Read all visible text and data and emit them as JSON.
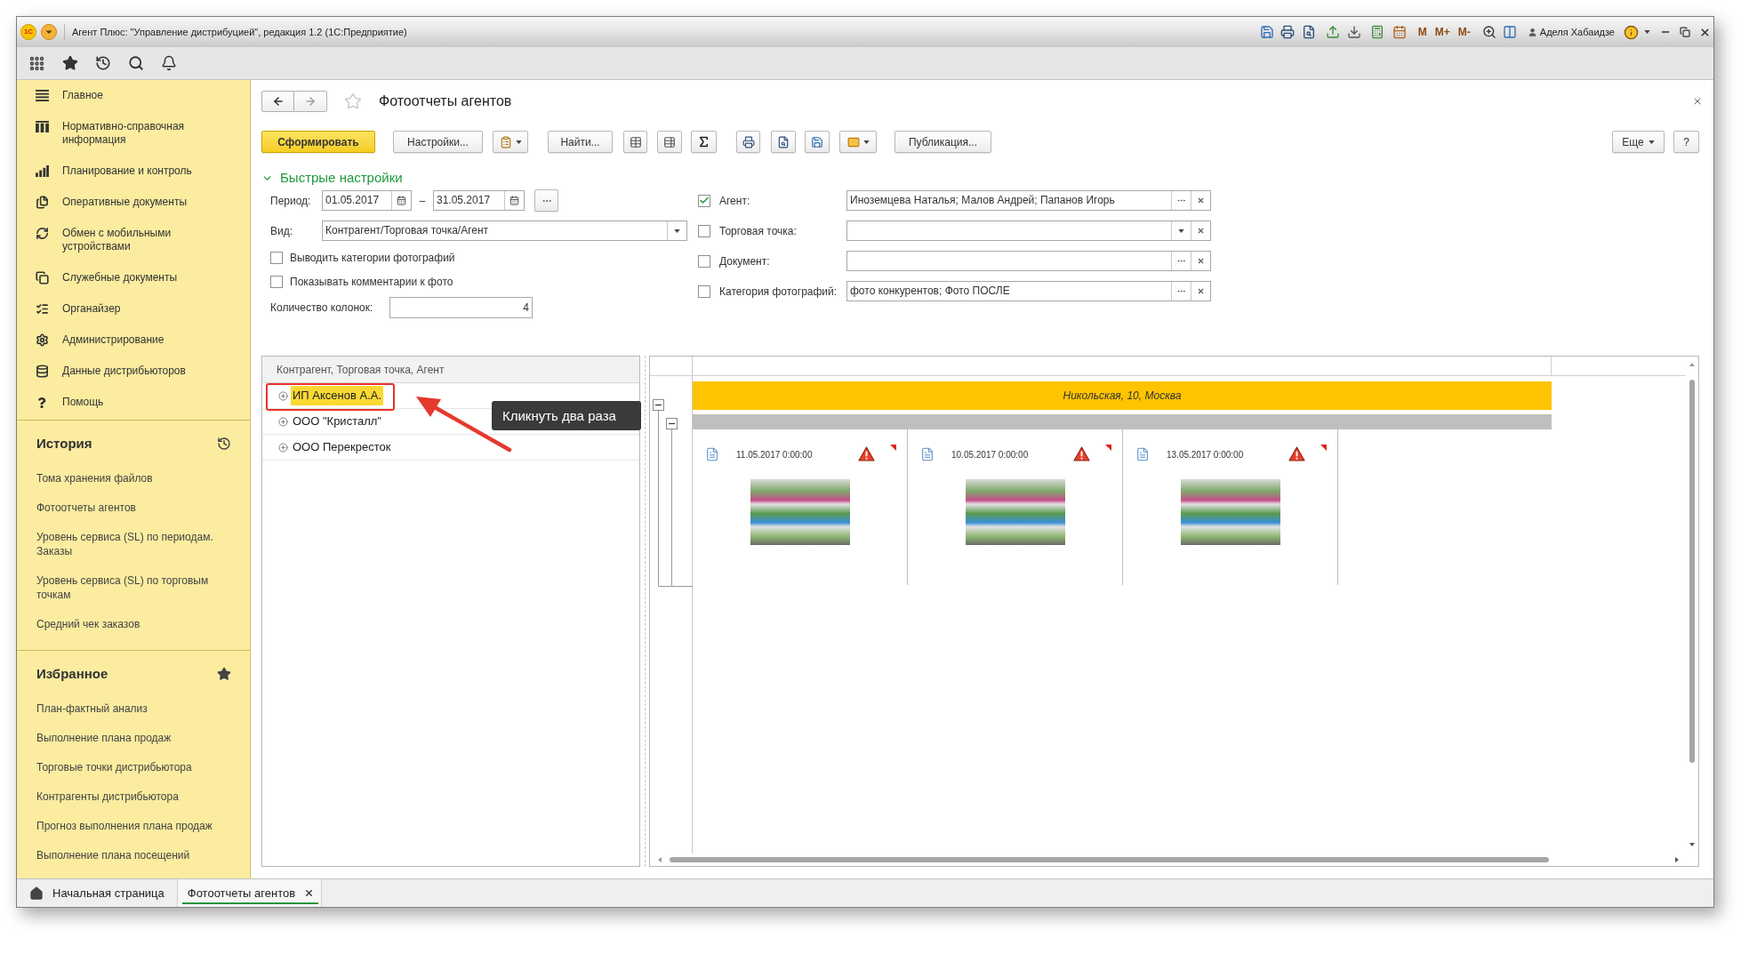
{
  "window": {
    "logo": "1С",
    "title": "Агент Плюс: \"Управление дистрибуцией\", редакция 1.2 (1С:Предприятие)",
    "memory_buttons": [
      "M",
      "M+",
      "M-"
    ],
    "user": "Аделя Хабаидзе"
  },
  "sidebar": {
    "sections": [
      "Главное",
      "Нормативно-справочная информация",
      "Планирование и контроль",
      "Оперативные документы",
      "Обмен с мобильными устройствами",
      "Служебные документы",
      "Органайзер",
      "Администрирование",
      "Данные дистрибьюторов",
      "Помощь"
    ],
    "history": {
      "title": "История",
      "items": [
        "Тома хранения файлов",
        "Фотоотчеты агентов",
        "Уровень сервиса (SL) по периодам. Заказы",
        "Уровень сервиса (SL) по торговым точкам",
        "Средний чек заказов"
      ]
    },
    "favorites": {
      "title": "Избранное",
      "items": [
        "План-фактный анализ",
        "Выполнение плана продаж",
        "Торговые точки дистрибьютора",
        "Контрагенты дистрибьютора",
        "Прогноз выполнения плана продаж",
        "Выполнение плана посещений"
      ]
    }
  },
  "form": {
    "title": "Фотоотчеты агентов",
    "favorite": false,
    "buttons": {
      "generate": "Сформировать",
      "settings": "Настройки...",
      "find": "Найти...",
      "publish": "Публикация...",
      "more": "Еще",
      "help": "?"
    },
    "quick_settings": {
      "title": "Быстрые настройки",
      "expanded": true,
      "period": {
        "label": "Период:",
        "from": "01.05.2017",
        "separator": "–",
        "to": "31.05.2017"
      },
      "view": {
        "label": "Вид:",
        "value": "Контрагент/Торговая точка/Агент"
      },
      "options": [
        {
          "label": "Выводить категории фотографий",
          "checked": false
        },
        {
          "label": "Показывать комментарии к фото",
          "checked": false
        }
      ],
      "columns_count": {
        "label": "Количество колонок:",
        "value": "4"
      },
      "filters": [
        {
          "kind": "choice",
          "label": "Агент:",
          "checked": true,
          "value": "Иноземцева Наталья; Малов Андрей; Папанов Игорь"
        },
        {
          "kind": "dropdown",
          "label": "Торговая точка:",
          "checked": false
        },
        {
          "kind": "choice",
          "label": "Документ:",
          "checked": false
        },
        {
          "kind": "choice",
          "label": "Категория фотографий:",
          "checked": false,
          "value": "фото конкурентов; Фото ПОСЛЕ"
        }
      ]
    }
  },
  "tree": {
    "header": "Контрагент, Торговая точка, Агент",
    "rows": [
      {
        "label": "ИП Аксенов А.А.",
        "selected": true,
        "expanded": false
      },
      {
        "label": "ООО \"Кристалл\"",
        "selected": false,
        "expanded": false
      },
      {
        "label": "ООО Перекресток",
        "selected": false,
        "expanded": false
      }
    ]
  },
  "annotation": {
    "tooltip": "Кликнуть два раза"
  },
  "report": {
    "group": "Никольская, 10, Москва",
    "photos": [
      {
        "date": "11.05.2017 0:00:00",
        "warning": true
      },
      {
        "date": "10.05.2017 0:00:00",
        "warning": true
      },
      {
        "date": "13.05.2017 0:00:00",
        "warning": true
      }
    ]
  },
  "tabs": [
    {
      "kind": "home",
      "label": "Начальная страница",
      "selected": false
    },
    {
      "kind": "page",
      "label": "Фотоотчеты агентов",
      "selected": true
    }
  ]
}
